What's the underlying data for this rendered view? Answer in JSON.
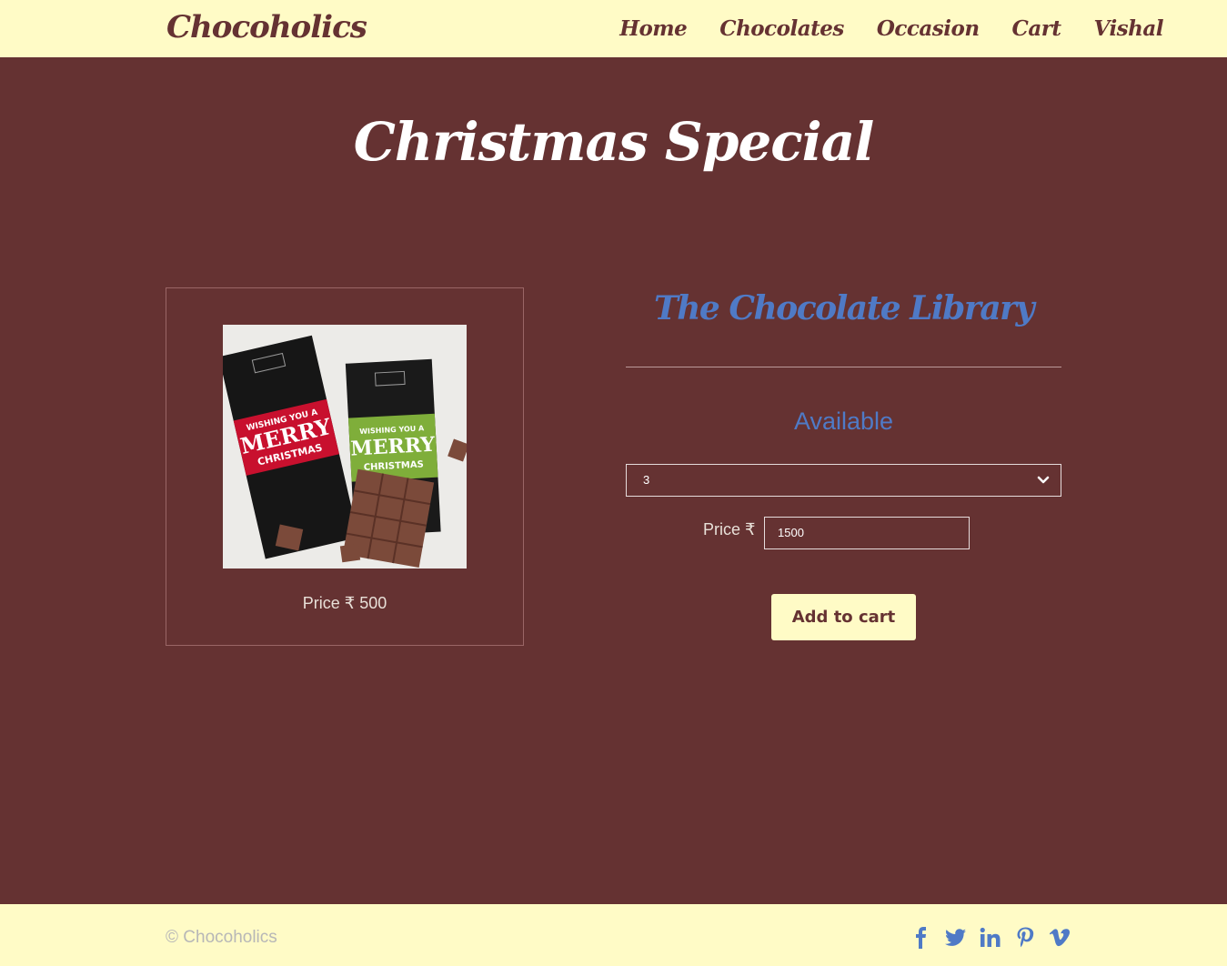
{
  "nav": {
    "brand": "Chocoholics",
    "links": [
      "Home",
      "Chocolates",
      "Occasion",
      "Cart",
      "Vishal"
    ]
  },
  "page": {
    "title": "Christmas Special"
  },
  "product": {
    "card_price": "Price ₹ 500",
    "brand": "The Chocolate Library",
    "availability": "Available",
    "quantity": "3",
    "price_label": "Price ₹",
    "price_value": "1500",
    "add_to_cart": "Add to cart",
    "image_text": {
      "wish": "WISHING YOU A",
      "merry": "MERRY",
      "christmas": "CHRISTMAS"
    }
  },
  "footer": {
    "copyright": "© Chocoholics",
    "social_icons": [
      "facebook-icon",
      "twitter-icon",
      "linkedin-icon",
      "pinterest-icon",
      "vimeo-icon"
    ]
  },
  "colors": {
    "background": "#653232",
    "cream": "#fffbc6",
    "accent_blue": "#4f7ac6"
  }
}
